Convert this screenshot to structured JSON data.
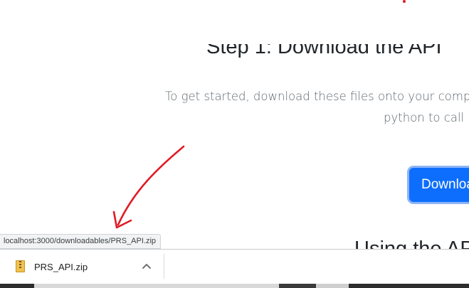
{
  "page": {
    "heading": "Step 1: Download the API",
    "lead_line1": "To get started, download these files onto your computer",
    "lead_line2": "python to call",
    "download_button_label": "Download",
    "next_heading": "Using the API"
  },
  "status_bar": {
    "link_url": "localhost:3000/downloadables/PRS_API.zip"
  },
  "download_shelf": {
    "file_name": "PRS_API.zip",
    "file_icon": "zip-file-icon",
    "menu_icon": "chevron-up-icon"
  },
  "annotation": {
    "arrow_color": "#e01b24"
  },
  "colors": {
    "primary_button": "#0d6efd",
    "heading_text": "#212529",
    "lead_text": "#5f676e"
  }
}
